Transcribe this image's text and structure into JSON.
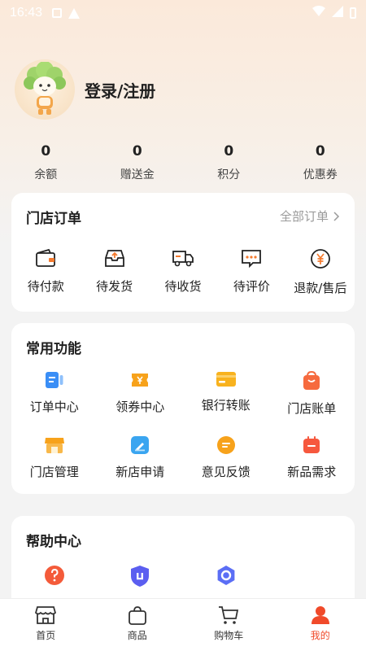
{
  "status_bar": {
    "time": "16:43"
  },
  "profile": {
    "login_label": "登录/注册"
  },
  "stats": [
    {
      "value": "0",
      "label": "余额"
    },
    {
      "value": "0",
      "label": "赠送金"
    },
    {
      "value": "0",
      "label": "积分"
    },
    {
      "value": "0",
      "label": "优惠券"
    }
  ],
  "store_orders": {
    "title": "门店订单",
    "all_orders_label": "全部订单",
    "items": [
      {
        "label": "待付款",
        "icon": "wallet-icon"
      },
      {
        "label": "待发货",
        "icon": "inbox-icon"
      },
      {
        "label": "待收货",
        "icon": "truck-icon"
      },
      {
        "label": "待评价",
        "icon": "comment-icon"
      },
      {
        "label": "退款/售后",
        "icon": "yen-icon"
      }
    ]
  },
  "common_functions": {
    "title": "常用功能",
    "items": [
      {
        "label": "订单中心",
        "icon": "order-center-icon",
        "color": "#3a8ef6"
      },
      {
        "label": "领券中心",
        "icon": "coupon-icon",
        "color": "#f7a21b"
      },
      {
        "label": "银行转账",
        "icon": "bank-card-icon",
        "color": "#f8b21e"
      },
      {
        "label": "门店账单",
        "icon": "store-bill-icon",
        "color": "#f66a3e"
      },
      {
        "label": "门店管理",
        "icon": "store-manage-icon",
        "color": "#f7a21b"
      },
      {
        "label": "新店申请",
        "icon": "new-store-icon",
        "color": "#3aa5f0"
      },
      {
        "label": "意见反馈",
        "icon": "feedback-icon",
        "color": "#f7a21b"
      },
      {
        "label": "新品需求",
        "icon": "new-product-icon",
        "color": "#f6583e"
      }
    ]
  },
  "help_center": {
    "title": "帮助中心",
    "items": [
      {
        "icon": "question-icon",
        "color": "#f45b3a"
      },
      {
        "icon": "shield-icon",
        "color": "#5b5ef0"
      },
      {
        "icon": "settings-ring-icon",
        "color": "#5b6ef5"
      }
    ]
  },
  "tabbar": {
    "items": [
      {
        "label": "首页",
        "icon": "store-home-icon"
      },
      {
        "label": "商品",
        "icon": "shopping-bag-icon"
      },
      {
        "label": "购物车",
        "icon": "cart-icon"
      },
      {
        "label": "我的",
        "icon": "user-icon",
        "active": true
      }
    ]
  },
  "colors": {
    "accent": "#f04a2a",
    "link_gray": "#9a9a9a"
  }
}
